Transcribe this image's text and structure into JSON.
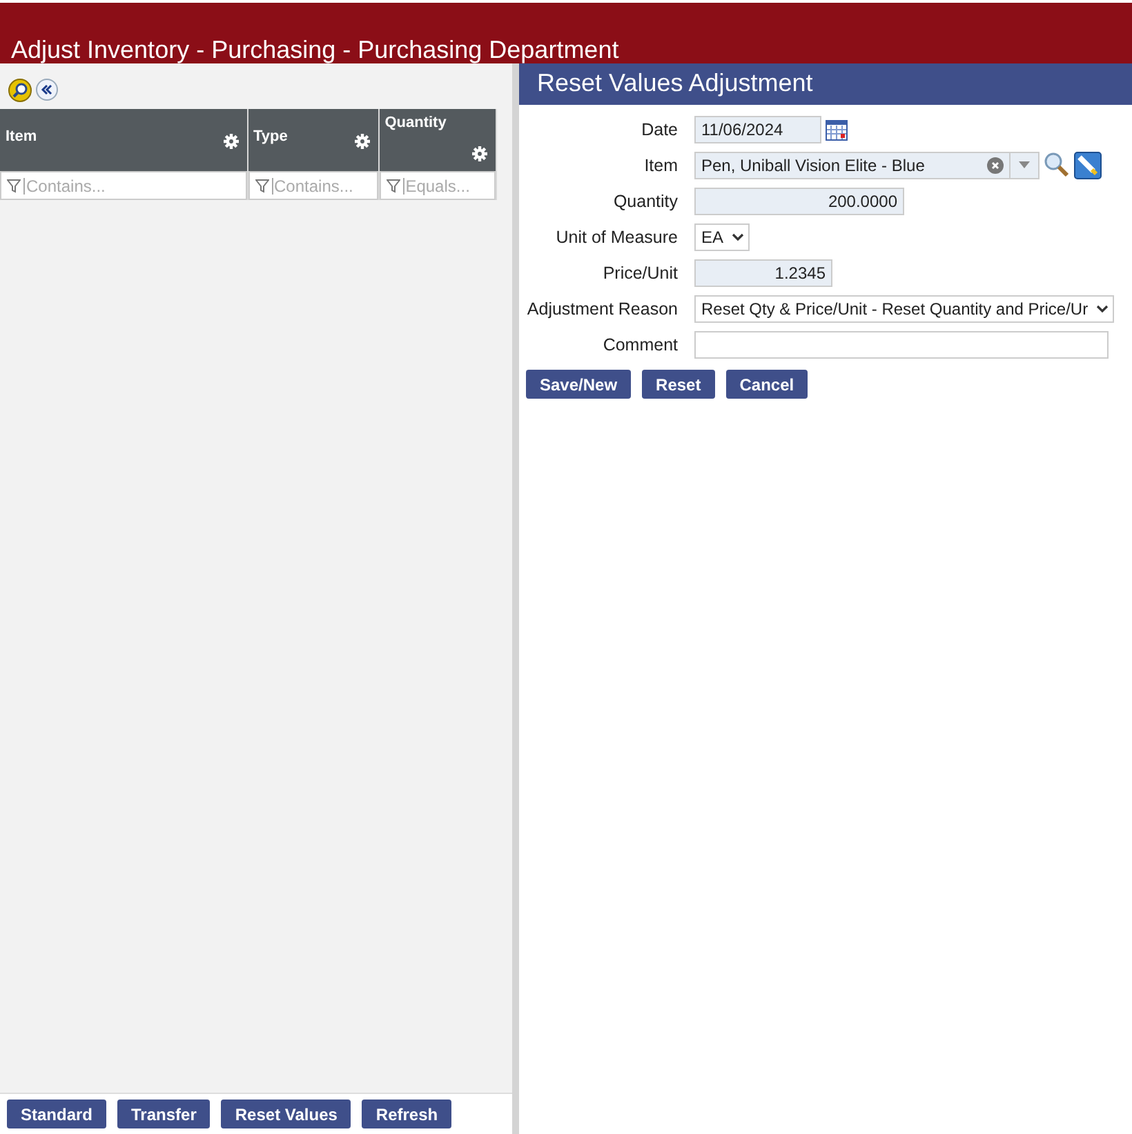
{
  "window": {
    "title": "Adjust Inventory - Purchasing - Purchasing Department"
  },
  "grid": {
    "columns": [
      {
        "label": "Item",
        "filter_placeholder": "Contains..."
      },
      {
        "label": "Type",
        "filter_placeholder": "Contains..."
      },
      {
        "label": "Quantity",
        "filter_placeholder": "Equals..."
      }
    ],
    "buttons": [
      "Standard",
      "Transfer",
      "Reset Values",
      "Refresh"
    ]
  },
  "form": {
    "title": "Reset Values Adjustment",
    "fields": [
      {
        "kind": "date",
        "label": "Date",
        "value": "11/06/2024"
      },
      {
        "kind": "combo",
        "label": "Item",
        "value": "Pen, Uniball Vision Elite - Blue"
      },
      {
        "kind": "number",
        "label": "Quantity",
        "value": "200.0000"
      },
      {
        "kind": "select",
        "label": "Unit of Measure",
        "value": "EA"
      },
      {
        "kind": "number",
        "label": "Price/Unit",
        "value": "1.2345"
      },
      {
        "kind": "select",
        "label": "Adjustment Reason",
        "value": "Reset Qty & Price/Unit - Reset Quantity and Price/Ur"
      },
      {
        "kind": "text",
        "label": "Comment"
      }
    ],
    "buttons": [
      "Save/New",
      "Reset",
      "Cancel"
    ]
  }
}
